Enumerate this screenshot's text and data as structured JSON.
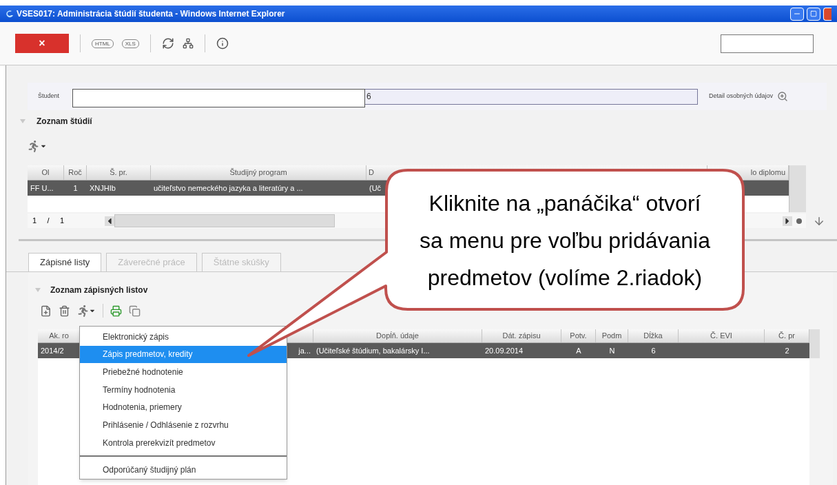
{
  "window": {
    "title": "VSES017: Administrácia štúdií študenta - Windows Internet Explorer"
  },
  "toolbar": {
    "close_label": "×",
    "export_buttons": [
      "HTML",
      "XLS"
    ]
  },
  "student": {
    "label": "Študent",
    "value": "6",
    "detail_link": "Detail osobných údajov"
  },
  "studies": {
    "title": "Zoznam štúdií",
    "row_selected": true,
    "columns": [
      {
        "header": "Ol",
        "cell": "FF U..."
      },
      {
        "header": "Roč",
        "cell": "1"
      },
      {
        "header": "Š. pr.",
        "cell": "XNJHIb"
      },
      {
        "header": "Študijný program",
        "cell": "učiteľstvo nemeckého jazyka a literatúry a ..."
      },
      {
        "header": "D",
        "cell": "(Uč"
      },
      {
        "header": "lo diplomu"
      }
    ],
    "pager": {
      "page": "1",
      "separator": "/",
      "total": "1"
    }
  },
  "tabs": [
    {
      "label": "Zápisné listy",
      "selected": true
    },
    {
      "label": "Záverečné práce",
      "selected": false
    },
    {
      "label": "Štátne skúšky",
      "selected": false
    }
  ],
  "enrollment": {
    "title": "Zoznam zápisných listov",
    "row_selected": true,
    "columns": [
      {
        "header": "Ak. ro",
        "cell": "2014/2"
      },
      {
        "cell": "ja..."
      },
      {
        "header": "Dopĺň. údaje",
        "cell": "(Učiteľské štúdium, bakalársky I..."
      },
      {
        "header": "Dát. zápisu",
        "cell": "20.09.2014"
      },
      {
        "header": "Potv.",
        "cell": "A"
      },
      {
        "header": "Podm",
        "cell": "N"
      },
      {
        "header": "Dĺžka",
        "cell": "6"
      },
      {
        "header": "Č. EVI"
      },
      {
        "header": "Č. pr",
        "cell": "2"
      }
    ]
  },
  "menu": [
    {
      "label": "Elektronický zápis",
      "selected": false,
      "separator_before": false
    },
    {
      "label": "Zápis predmetov, kredity",
      "selected": true,
      "separator_before": false
    },
    {
      "label": "Priebežné hodnotenie",
      "selected": false,
      "separator_before": false
    },
    {
      "label": "Termíny hodnotenia",
      "selected": false,
      "separator_before": false
    },
    {
      "label": "Hodnotenia, priemery",
      "selected": false,
      "separator_before": false
    },
    {
      "label": "Prihlásenie / Odhlásenie z rozvrhu",
      "selected": false,
      "separator_before": false
    },
    {
      "label": "Kontrola prerekvizít predmetov",
      "selected": false,
      "separator_before": false
    },
    {
      "label": "Odporúčaný študijný plán",
      "selected": false,
      "separator_before": true
    }
  ],
  "callout": {
    "lines": [
      "Kliknite na „panáčika“ otvorí",
      "sa menu pre voľbu pridávania",
      "predmetov (volíme 2.riadok)"
    ]
  }
}
